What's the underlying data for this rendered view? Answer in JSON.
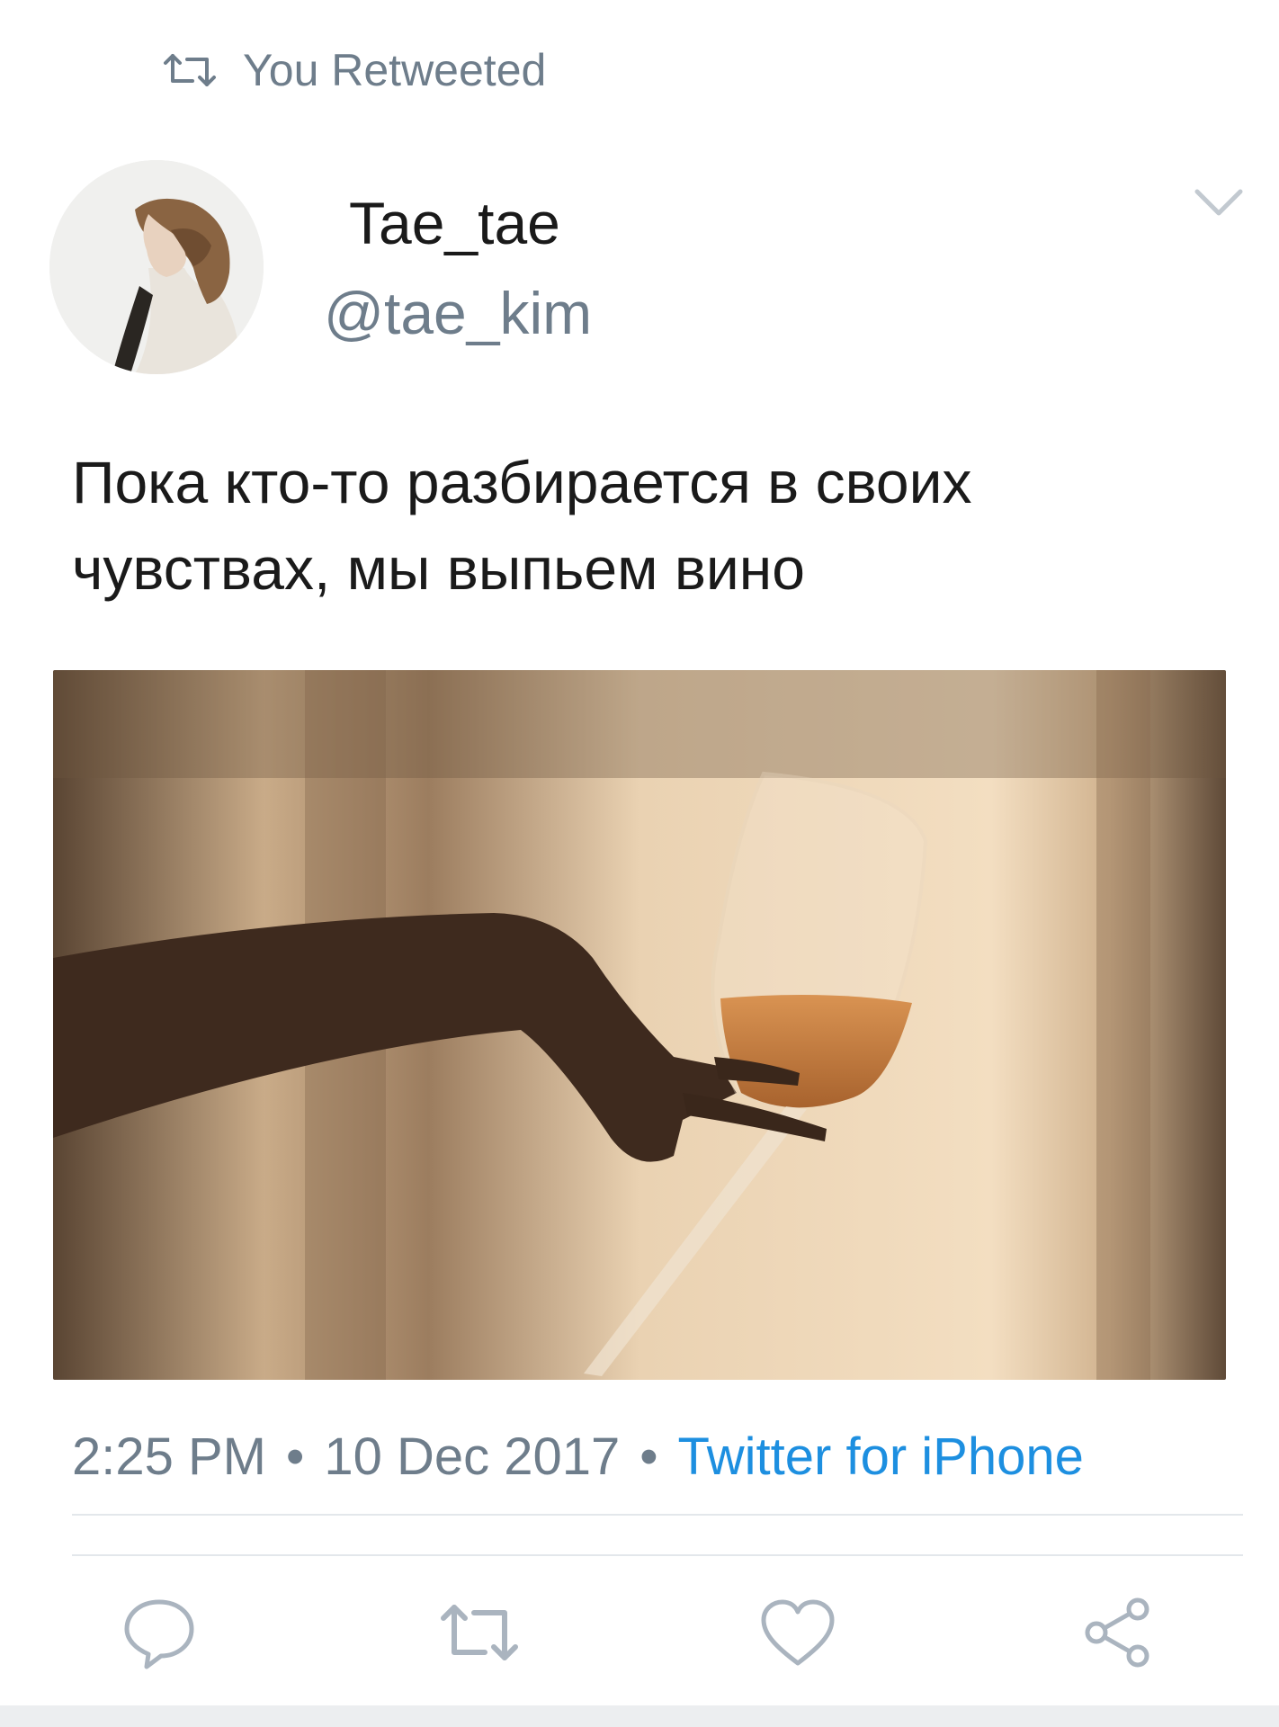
{
  "retweet_banner": {
    "icon": "retweet-icon",
    "label": "You Retweeted"
  },
  "author": {
    "display_name": "Tae_tae",
    "handle": "@tae_kim",
    "avatar": "profile-photo"
  },
  "tweet": {
    "text": "Пока кто-то разбирается в своих чувствах, мы выпьем вино",
    "media": "photo: hand holding a wine glass against a warm wall with window shadows"
  },
  "meta": {
    "time": "2:25 PM",
    "date": "10 Dec 2017",
    "source": "Twitter for iPhone",
    "separator": "•"
  },
  "actions": [
    {
      "name": "reply",
      "icon": "reply-icon"
    },
    {
      "name": "retweet",
      "icon": "retweet-icon"
    },
    {
      "name": "like",
      "icon": "heart-icon"
    },
    {
      "name": "share",
      "icon": "share-icon"
    }
  ],
  "colors": {
    "accent": "#1d8fe0",
    "muted": "#6e7d8b",
    "text": "#1a1a1a",
    "divider": "#e3e7eb"
  }
}
